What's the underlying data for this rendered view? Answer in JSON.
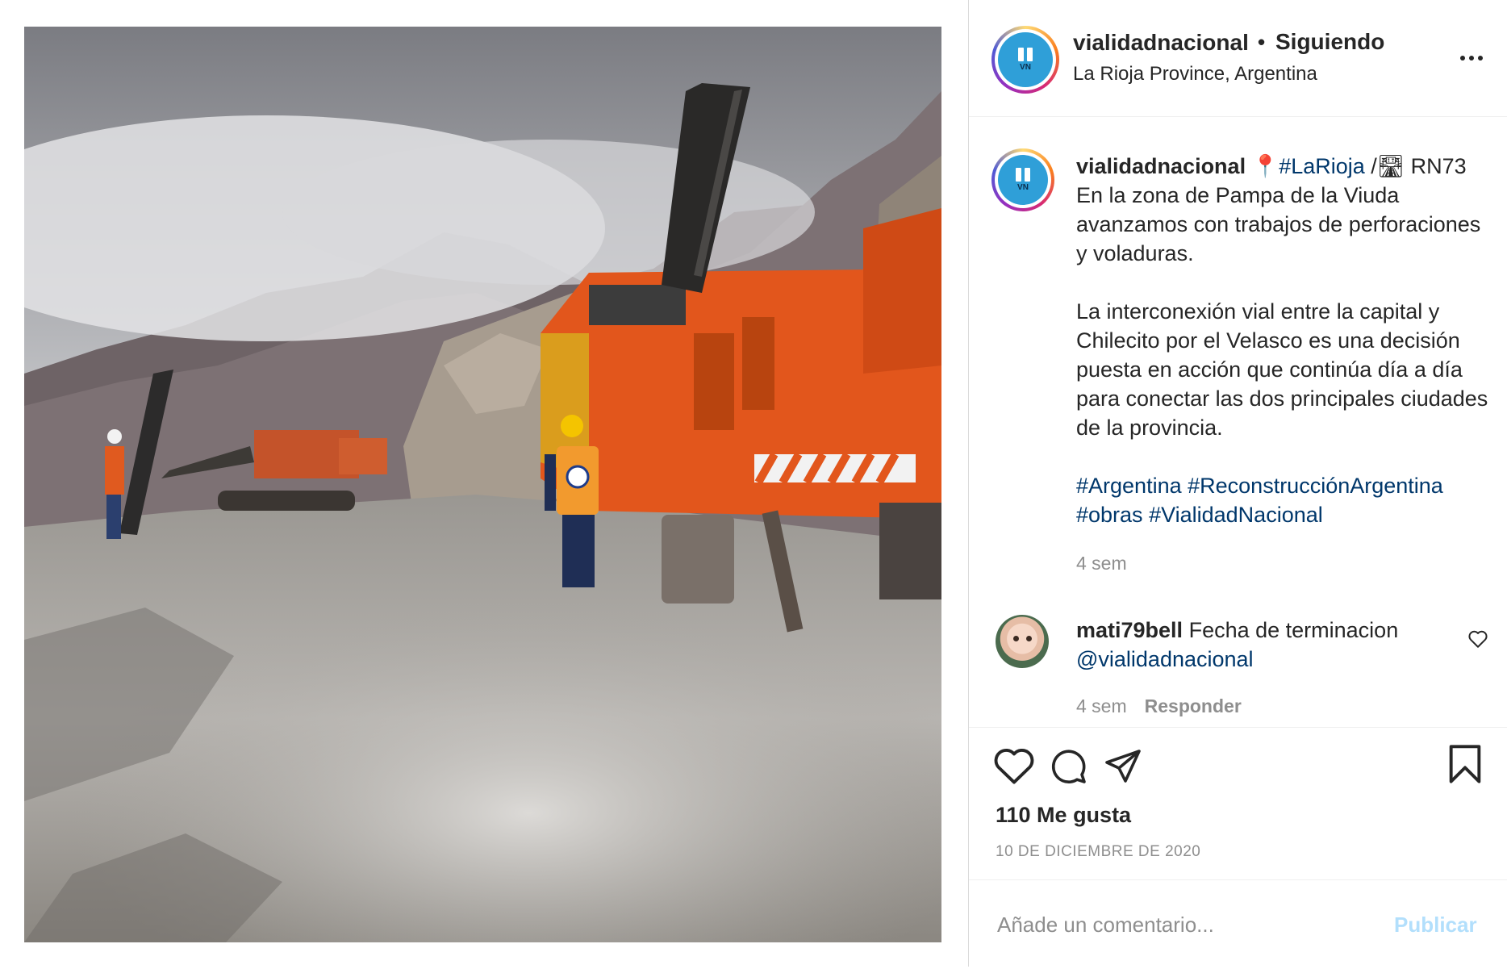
{
  "post": {
    "image_alt": "Obras viales con perforadoras en La Rioja",
    "colors": {
      "link": "#00376b",
      "text": "#262626",
      "muted": "#8e8e8e",
      "publish_disabled": "#b2dffc",
      "avatar_blue": "#2f9fd8"
    },
    "icons": [
      "more-icon",
      "heart-icon",
      "comment-icon",
      "share-icon",
      "save-icon"
    ]
  },
  "header": {
    "username": "vialidadnacional",
    "separator": "•",
    "follow_status": "Siguiendo",
    "location": "La Rioja Province, Argentina",
    "avatar_text": "VN"
  },
  "caption": {
    "username": "vialidadnacional",
    "pin": "📍",
    "location_tag": "#LaRioja",
    "route_prefix": " /🛣 ",
    "route": "RN73",
    "line1": "En la zona de Pampa de la Viuda avanzamos con trabajos de perforaciones y voladuras.",
    "line2": "La interconexión vial entre la capital y Chilecito por el Velasco es una decisión puesta en acción que continúa día a día para conectar las dos principales ciudades de la provincia.",
    "hashtags": [
      "#Argentina",
      "#ReconstrucciónArgentina",
      "#obras",
      "#VialidadNacional"
    ],
    "time": "4 sem"
  },
  "comment": {
    "username": "mati79bell",
    "text": "Fecha de terminacion",
    "mention": "@vialidadnacional",
    "time": "4 sem",
    "reply_label": "Responder"
  },
  "actions": {
    "likes": "110 Me gusta",
    "date": "10 DE DICIEMBRE DE 2020"
  },
  "add_comment": {
    "placeholder": "Añade un comentario...",
    "publish_label": "Publicar"
  }
}
